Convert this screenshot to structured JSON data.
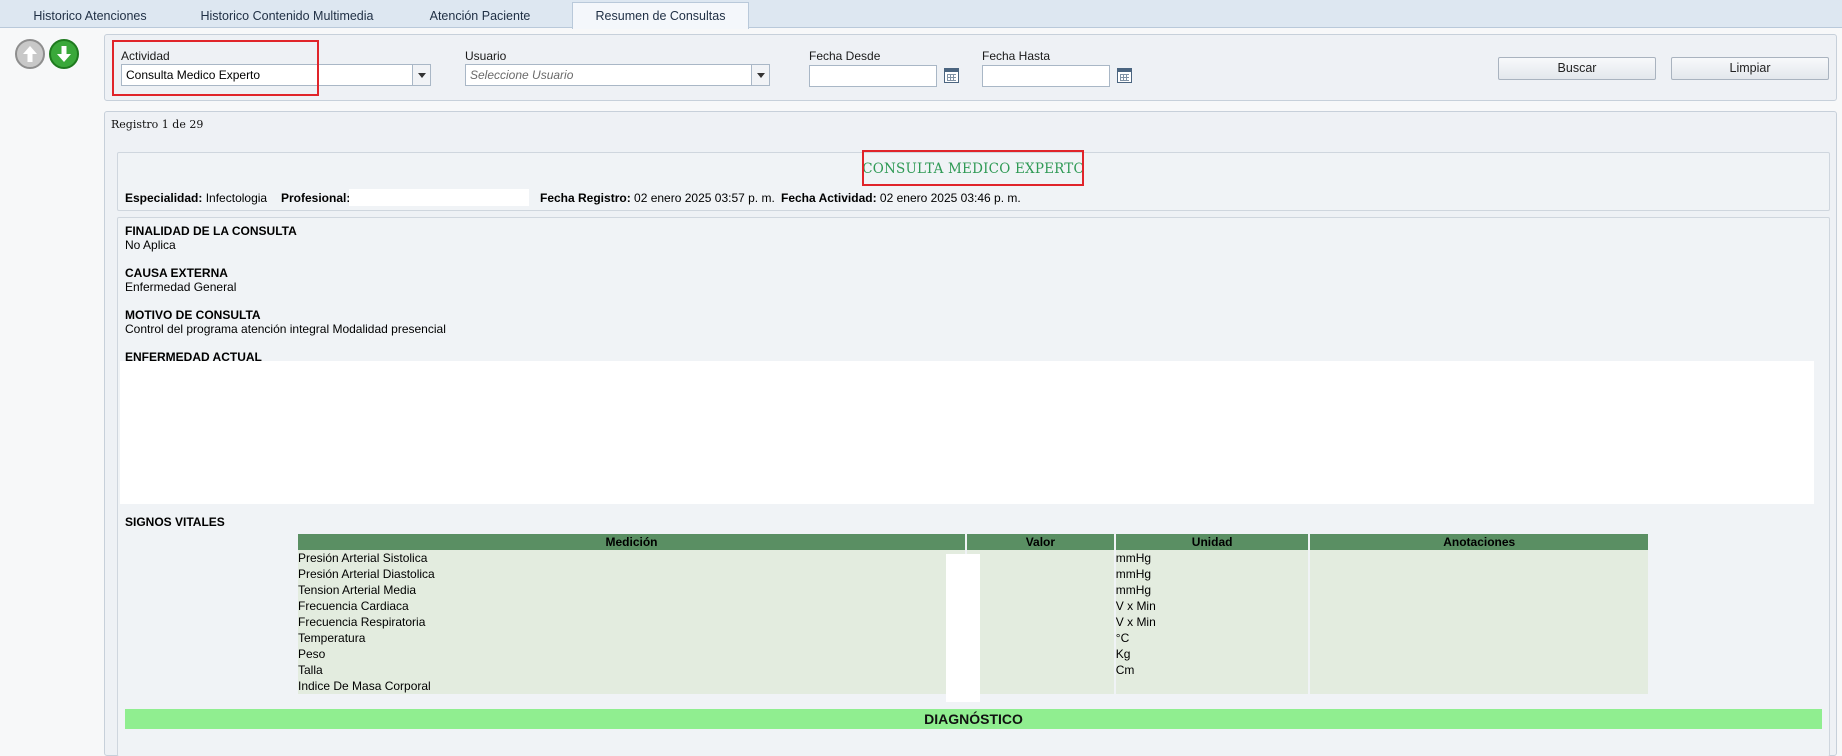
{
  "tabs": [
    {
      "label": "Historico Atenciones",
      "active": false
    },
    {
      "label": "Historico Contenido Multimedia",
      "active": false
    },
    {
      "label": "Atención Paciente",
      "active": false
    },
    {
      "label": "Resumen de Consultas",
      "active": true
    }
  ],
  "nav_icons": [
    "arrow-up-icon",
    "arrow-down-icon"
  ],
  "filters": {
    "actividad": {
      "label": "Actividad",
      "value": "Consulta Medico Experto"
    },
    "usuario": {
      "label": "Usuario",
      "placeholder": "Seleccione Usuario"
    },
    "fecha_desde": {
      "label": "Fecha Desde",
      "value": ""
    },
    "fecha_hasta": {
      "label": "Fecha Hasta",
      "value": ""
    },
    "buscar_label": "Buscar",
    "limpiar_label": "Limpiar"
  },
  "results": {
    "record_count": "Registro 1 de 29",
    "title": "CONSULTA MEDICO EXPERTO",
    "especialidad_label": "Especialidad:",
    "especialidad": "Infectologia",
    "profesional_label": "Profesional:",
    "profesional": "",
    "fecha_registro_label": "Fecha Registro:",
    "fecha_registro": "02 enero 2025 03:57 p. m.",
    "fecha_actividad_label": "Fecha Actividad:",
    "fecha_actividad": "02 enero 2025 03:46 p. m."
  },
  "sections": {
    "finalidad_title": "FINALIDAD DE LA CONSULTA",
    "finalidad_value": "No Aplica",
    "causa_title": "CAUSA EXTERNA",
    "causa_value": "Enfermedad General",
    "motivo_title": "MOTIVO DE CONSULTA",
    "motivo_value": "Control del programa atención integral Modalidad presencial",
    "enfermedad_title": "ENFERMEDAD ACTUAL",
    "enfermedad_value": "",
    "signos_title": "SIGNOS VITALES",
    "diagnostico_title": "DIAGNÓSTICO"
  },
  "vitals": {
    "headers": [
      "Medición",
      "Valor",
      "Unidad",
      "Anotaciones"
    ],
    "rows": [
      {
        "medicion": "Presión Arterial Sistolica",
        "valor": "",
        "unidad": "mmHg",
        "anotaciones": ""
      },
      {
        "medicion": "Presión Arterial Diastolica",
        "valor": "",
        "unidad": "mmHg",
        "anotaciones": ""
      },
      {
        "medicion": "Tension Arterial Media",
        "valor": "",
        "unidad": "mmHg",
        "anotaciones": ""
      },
      {
        "medicion": "Frecuencia Cardiaca",
        "valor": "",
        "unidad": "V x Min",
        "anotaciones": ""
      },
      {
        "medicion": "Frecuencia Respiratoria",
        "valor": "",
        "unidad": "V x Min",
        "anotaciones": ""
      },
      {
        "medicion": "Temperatura",
        "valor": "",
        "unidad": "°C",
        "anotaciones": ""
      },
      {
        "medicion": "Peso",
        "valor": "",
        "unidad": "Kg",
        "anotaciones": ""
      },
      {
        "medicion": "Talla",
        "valor": "",
        "unidad": "Cm",
        "anotaciones": ""
      },
      {
        "medicion": "Indice De Masa Corporal",
        "valor": "",
        "unidad": "",
        "anotaciones": ""
      }
    ]
  },
  "colors": {
    "title_green": "#2f9a55",
    "table_header": "#5a8f63",
    "diagnostico_bar": "#90ee90",
    "highlight_red": "#e0242a"
  }
}
